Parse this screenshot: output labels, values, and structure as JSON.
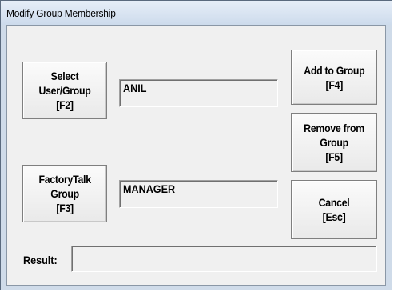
{
  "window": {
    "title": "Modify Group Membership"
  },
  "buttons": {
    "select_user_group": "Select\nUser/Group\n[F2]",
    "factorytalk_group": "FactoryTalk\nGroup\n[F3]",
    "add_to_group": "Add to Group\n[F4]",
    "remove_from_group": "Remove from\nGroup\n[F5]",
    "cancel": "Cancel\n[Esc]"
  },
  "fields": {
    "user_value": "ANIL",
    "group_value": "MANAGER",
    "result_label": "Result:",
    "result_value": ""
  }
}
